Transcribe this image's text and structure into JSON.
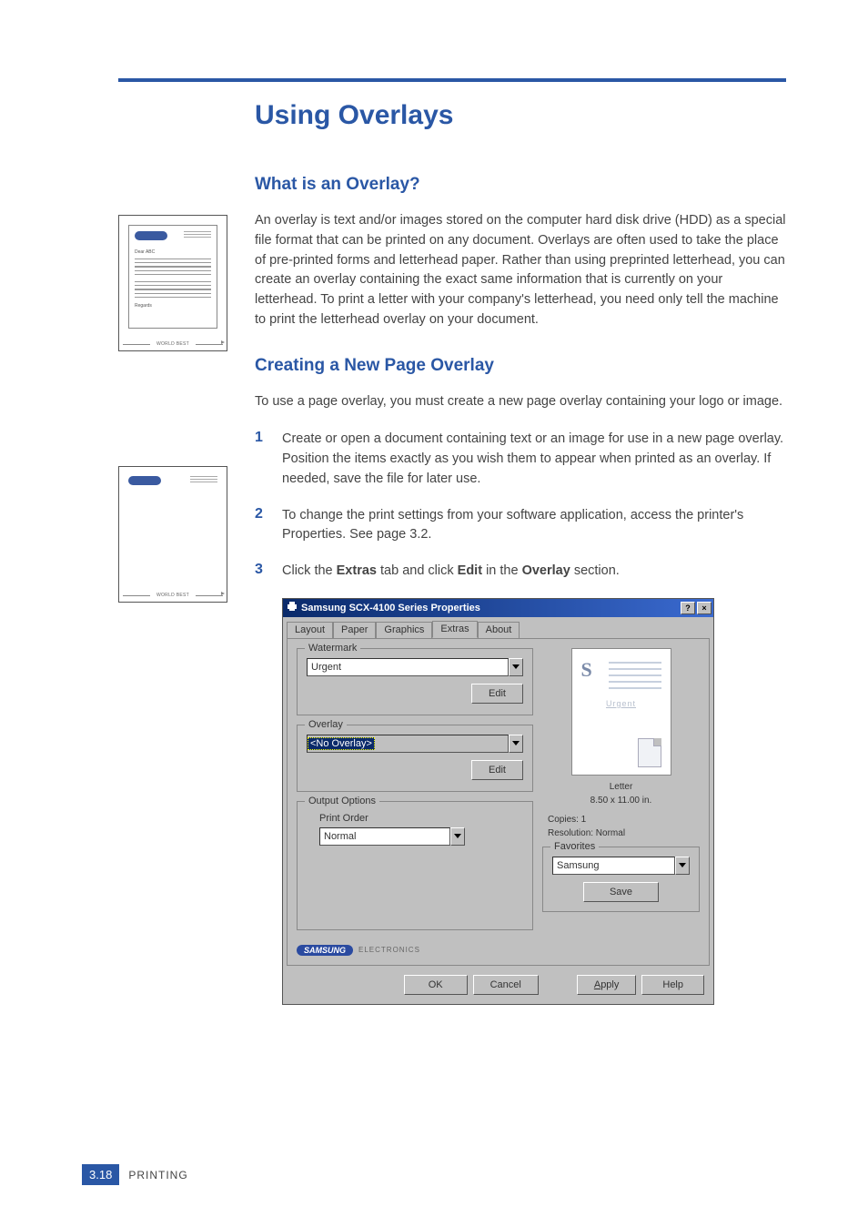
{
  "page": {
    "title": "Using Overlays",
    "section1": {
      "heading": "What is an Overlay?",
      "body": "An overlay is text and/or images stored on the computer hard disk drive (HDD) as a special file format that can be printed on any document. Overlays are often used to take the place of pre-printed forms and letterhead paper. Rather than using preprinted letterhead, you can create an overlay containing the exact same information that is currently on your letterhead. To print a letter with your company's letterhead, you need only tell the machine to print the letterhead overlay on your document."
    },
    "section2": {
      "heading": "Creating a New Page Overlay",
      "intro": "To use a page overlay, you must create a new page overlay containing your logo or image.",
      "steps": [
        {
          "n": "1",
          "text": "Create or open a document containing text or an image for use in a new page overlay. Position the items exactly as you wish them to appear when printed as an overlay. If needed, save the file for later use."
        },
        {
          "n": "2",
          "text": "To change the print settings from your software application, access the printer's Properties. See page 3.2."
        },
        {
          "n": "3",
          "prefix": "Click the ",
          "b1": "Extras",
          "mid1": " tab and click ",
          "b2": "Edit",
          "mid2": " in the ",
          "b3": "Overlay",
          "suffix": " section."
        }
      ]
    },
    "illus": {
      "dear": "Dear ABC",
      "regards": "Regards",
      "worldbest": "WORLD BEST"
    },
    "footer": {
      "num": "3.18",
      "label": "PRINTING"
    }
  },
  "dialog": {
    "title": "Samsung SCX-4100 Series Properties",
    "help_btn": "?",
    "close_btn": "×",
    "tabs": [
      "Layout",
      "Paper",
      "Graphics",
      "Extras",
      "About"
    ],
    "active_tab": "Extras",
    "watermark": {
      "legend": "Watermark",
      "value": "Urgent",
      "edit": "Edit"
    },
    "overlay": {
      "legend": "Overlay",
      "value": "<No Overlay>",
      "edit": "Edit"
    },
    "output": {
      "legend": "Output Options",
      "print_order_label": "Print Order",
      "print_order_value": "Normal"
    },
    "preview": {
      "s": "S",
      "urgent": "Urgent",
      "paper": "Letter",
      "size": "8.50 x 11.00 in.",
      "copies": "Copies: 1",
      "resolution": "Resolution: Normal"
    },
    "favorites": {
      "legend": "Favorites",
      "value": "Samsung",
      "save": "Save"
    },
    "brand": {
      "name": "SAMSUNG",
      "sub": "ELECTRONICS"
    },
    "buttons": {
      "ok": "OK",
      "cancel": "Cancel",
      "apply_letter": "A",
      "apply_rest": "pply",
      "help": "Help"
    }
  }
}
